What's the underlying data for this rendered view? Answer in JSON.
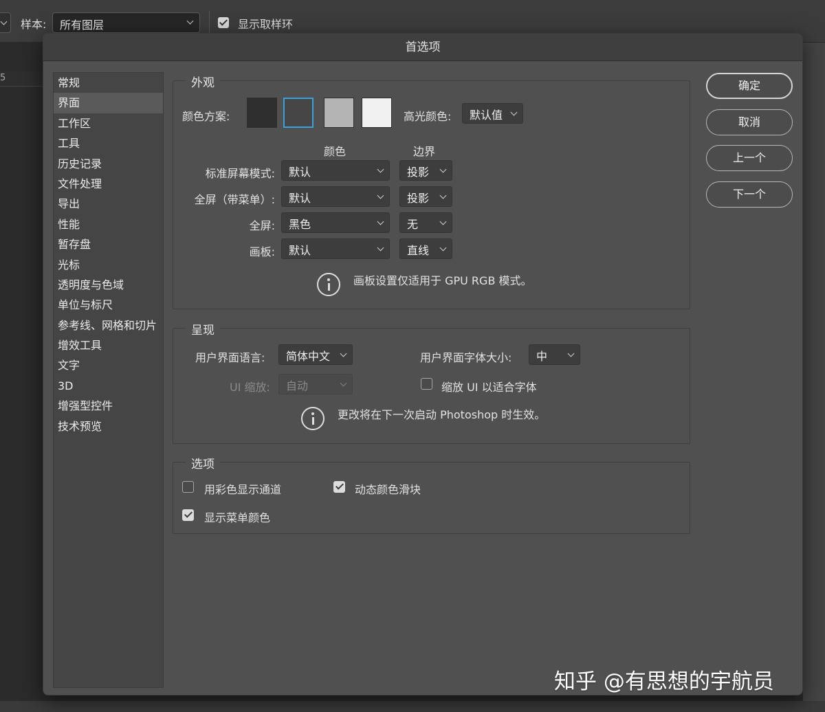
{
  "appbar": {
    "sample_label": "样本:",
    "sample_value": "所有图层",
    "show_ring_label": "显示取样环",
    "show_ring_checked": true
  },
  "ruler": {
    "tick": "5"
  },
  "dialog": {
    "title": "首选项",
    "categories": [
      "常规",
      "界面",
      "工作区",
      "工具",
      "历史记录",
      "文件处理",
      "导出",
      "性能",
      "暂存盘",
      "光标",
      "透明度与色域",
      "单位与标尺",
      "参考线、网格和切片",
      "增效工具",
      "文字",
      "3D",
      "增强型控件",
      "技术预览"
    ],
    "active_category": "界面",
    "buttons": {
      "ok": "确定",
      "cancel": "取消",
      "prev": "上一个",
      "next": "下一个"
    },
    "appearance": {
      "title": "外观",
      "color_scheme_label": "颜色方案:",
      "swatches": [
        "#2f2f2f",
        "#454545",
        "#b4b4b4",
        "#f0f0f0"
      ],
      "selected_swatch": 1,
      "highlight_label": "高光颜色:",
      "highlight_value": "默认值",
      "col_color": "颜色",
      "col_border": "边界",
      "rows": [
        {
          "label": "标准屏幕模式:",
          "color": "默认",
          "border": "投影"
        },
        {
          "label": "全屏（带菜单）:",
          "color": "默认",
          "border": "投影"
        },
        {
          "label": "全屏:",
          "color": "黑色",
          "border": "无"
        },
        {
          "label": "画板:",
          "color": "默认",
          "border": "直线"
        }
      ],
      "note": "画板设置仅适用于 GPU RGB 模式。"
    },
    "presentation": {
      "title": "呈现",
      "lang_label": "用户界面语言:",
      "lang_value": "简体中文",
      "font_size_label": "用户界面字体大小:",
      "font_size_value": "中",
      "ui_scale_label": "UI 缩放:",
      "ui_scale_value": "自动",
      "scale_ui_label": "缩放 UI 以适合字体",
      "scale_ui_checked": false,
      "note": "更改将在下一次启动 Photoshop 时生效。"
    },
    "options": {
      "title": "选项",
      "channels_color_label": "用彩色显示通道",
      "channels_color_checked": false,
      "dynamic_sliders_label": "动态颜色滑块",
      "dynamic_sliders_checked": true,
      "menu_colors_label": "显示菜单颜色",
      "menu_colors_checked": true
    }
  },
  "watermark": "知乎 @有思想的宇航员"
}
